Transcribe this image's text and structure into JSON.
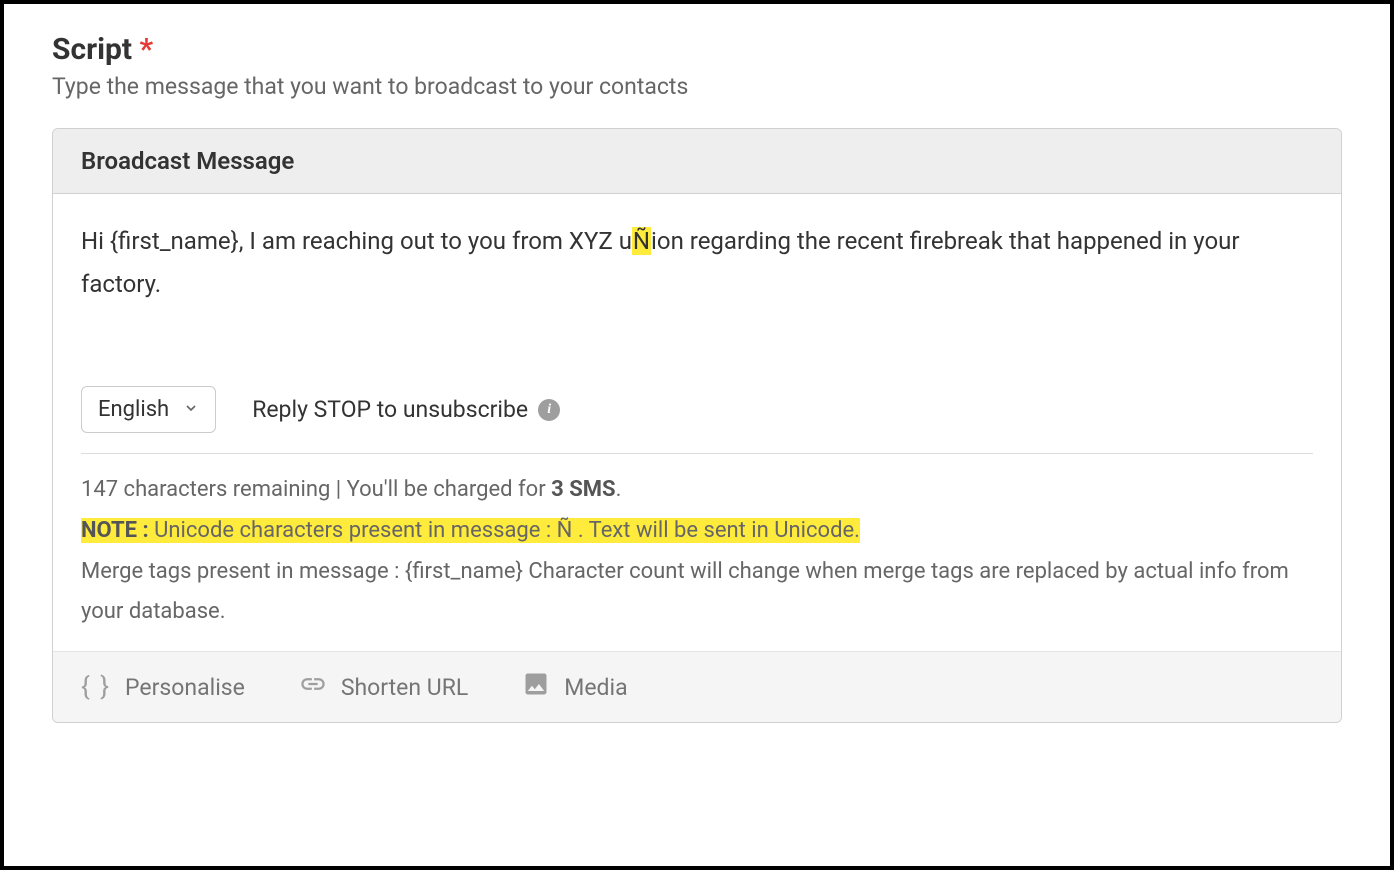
{
  "section": {
    "title": "Script",
    "required_mark": "*",
    "subtitle": "Type the message that you want to broadcast to your contacts"
  },
  "card": {
    "header": "Broadcast Message",
    "message": {
      "part1": "Hi {first_name}, I am reaching out to you from XYZ u",
      "highlighted_char": "Ñ",
      "part2": "ion regarding the recent firebreak that happened in your factory."
    },
    "language_select": {
      "value": "English"
    },
    "unsubscribe_text": "Reply STOP to unsubscribe",
    "meta": {
      "chars_remaining_text": "147 characters remaining | You'll be charged for ",
      "sms_count_text": "3 SMS",
      "period": ".",
      "note_label": "NOTE : ",
      "note_text_1": "Unicode characters present in message : ",
      "note_char": "Ñ",
      "note_text_2": " . Text will be sent in Unicode.",
      "merge_tags_text": "Merge tags present in message : {first_name} Character count will change when merge tags are replaced by actual info from your database."
    },
    "footer": {
      "personalise": "Personalise",
      "shorten_url": "Shorten URL",
      "media": "Media"
    }
  }
}
